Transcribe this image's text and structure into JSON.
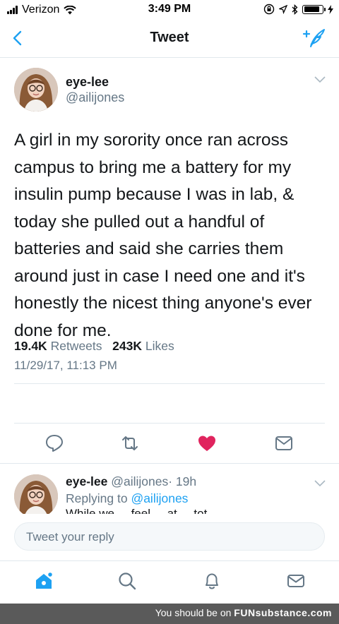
{
  "status_bar": {
    "carrier": "Verizon",
    "time": "3:49 PM",
    "icons": [
      "signal-icon",
      "wifi-icon",
      "lock-rotation-icon",
      "location-icon",
      "bluetooth-icon",
      "battery-icon",
      "charging-icon"
    ],
    "battery_level": 0.85
  },
  "nav": {
    "title": "Tweet",
    "back_icon": "chevron-left-icon",
    "compose_icon": "compose-tweet-icon",
    "accent": "#1da1f2"
  },
  "tweet": {
    "author_name": "eye-lee",
    "author_handle": "@ailijones",
    "text": "A girl in my sorority once ran across campus to bring me a battery for my insulin pump because I was in lab, & today she pulled out a handful of batteries and said she carries them around just in case I need one and it's honestly the nicest thing anyone's ever done for me.",
    "timestamp": "11/29/17, 11:13 PM",
    "retweets_count": "19.4K",
    "retweets_label": "Retweets",
    "likes_count": "243K",
    "likes_label": "Likes",
    "liked": true,
    "like_color": "#e0245e"
  },
  "reply": {
    "author_name": "eye-lee",
    "author_handle": "@ailijones",
    "age": "· 19h",
    "replying_prefix": "Replying to",
    "replying_to": "@ailijones",
    "snippet": "While we ... feel ... at ... tot..."
  },
  "reply_input": {
    "placeholder": "Tweet your reply"
  },
  "tabbar": {
    "tabs": [
      "home-icon",
      "search-icon",
      "notifications-icon",
      "messages-icon"
    ],
    "active": "home-icon"
  },
  "watermark": {
    "prefix": "You should be on",
    "brand": "FUNsubstance.com"
  }
}
